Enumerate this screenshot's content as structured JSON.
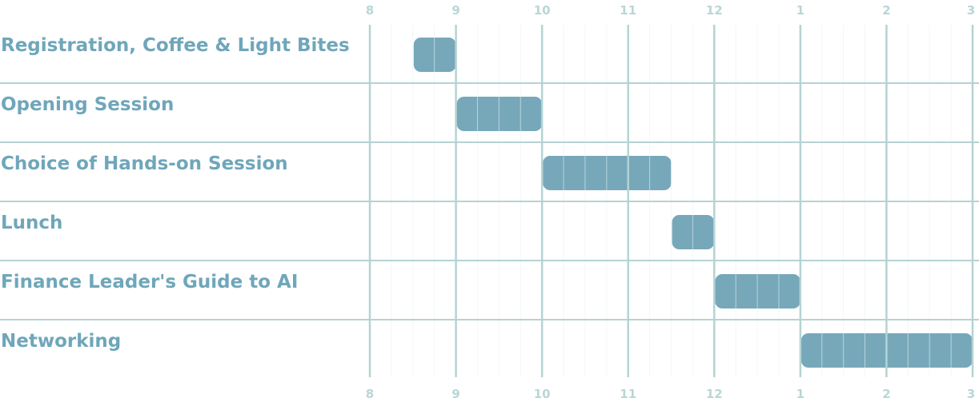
{
  "chart_data": {
    "type": "gantt",
    "title": "",
    "xlabel": "",
    "ylabel": "",
    "xlim": [
      8,
      15
    ],
    "x_ticks": [
      8,
      9,
      10,
      11,
      12,
      13,
      14,
      15
    ],
    "x_tick_labels": [
      "8",
      "9",
      "10",
      "11",
      "12",
      "1",
      "2",
      "3"
    ],
    "minor_tick_interval_hours": 0.25,
    "grid": true,
    "tasks": [
      {
        "label": "Registration, Coffee & Light Bites",
        "start": 8.5,
        "end": 9
      },
      {
        "label": "Opening Session",
        "start": 9,
        "end": 10
      },
      {
        "label": "Choice of Hands-on Session",
        "start": 10,
        "end": 11.5
      },
      {
        "label": "Lunch",
        "start": 11.5,
        "end": 12
      },
      {
        "label": "Finance Leader's Guide to AI",
        "start": 12,
        "end": 13
      },
      {
        "label": "Networking",
        "start": 13,
        "end": 15
      }
    ],
    "colors": {
      "bar": "#76a8ba",
      "label": "#6fa6ba",
      "major_grid": "#b5d3d3",
      "minor_grid": "#e8f1f1",
      "tick": "#b9d6d6"
    }
  }
}
